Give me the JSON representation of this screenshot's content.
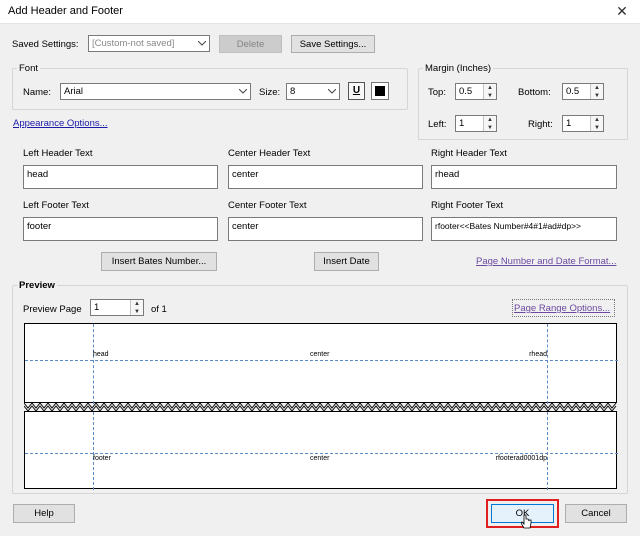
{
  "window": {
    "title": "Add Header and Footer",
    "close_glyph": "✕"
  },
  "saved_settings": {
    "label": "Saved Settings:",
    "value": "[Custom-not saved]",
    "delete_label": "Delete",
    "save_label": "Save Settings..."
  },
  "font": {
    "group_label": "Font",
    "name_label": "Name:",
    "name_value": "Arial",
    "size_label": "Size:",
    "size_value": "8",
    "underline_glyph": "U"
  },
  "margin": {
    "group_label": "Margin (Inches)",
    "top_label": "Top:",
    "top_value": "0.5",
    "bottom_label": "Bottom:",
    "bottom_value": "0.5",
    "left_label": "Left:",
    "left_value": "1",
    "right_label": "Right:",
    "right_value": "1"
  },
  "appearance_link": "Appearance Options...",
  "header_footer": {
    "left_header_label": "Left Header Text",
    "left_header_value": "head",
    "center_header_label": "Center Header Text",
    "center_header_value": "center",
    "right_header_label": "Right Header Text",
    "right_header_value": "rhead",
    "left_footer_label": "Left Footer Text",
    "left_footer_value": "footer",
    "center_footer_label": "Center Footer Text",
    "center_footer_value": "center",
    "right_footer_label": "Right Footer Text",
    "right_footer_value": "rfooter<<Bates Number#4#1#ad#dp>>"
  },
  "insert_bates_label": "Insert Bates Number...",
  "insert_date_label": "Insert Date",
  "page_number_link": "Page Number and Date Format...",
  "preview": {
    "group_label": "Preview",
    "page_label": "Preview Page",
    "page_value": "1",
    "of_label": "of 1",
    "range_link": "Page Range Options...",
    "header_left": "head",
    "header_center": "center",
    "header_right": "rhead",
    "footer_left": "footer",
    "footer_center": "center",
    "footer_right": "rfooterad0001dp"
  },
  "buttons": {
    "help": "Help",
    "ok": "OK",
    "cancel": "Cancel"
  },
  "colors": {
    "ok_highlight": "#e02020",
    "link_blue": "#1a1aa6",
    "guide_blue": "#5b8ac6"
  }
}
